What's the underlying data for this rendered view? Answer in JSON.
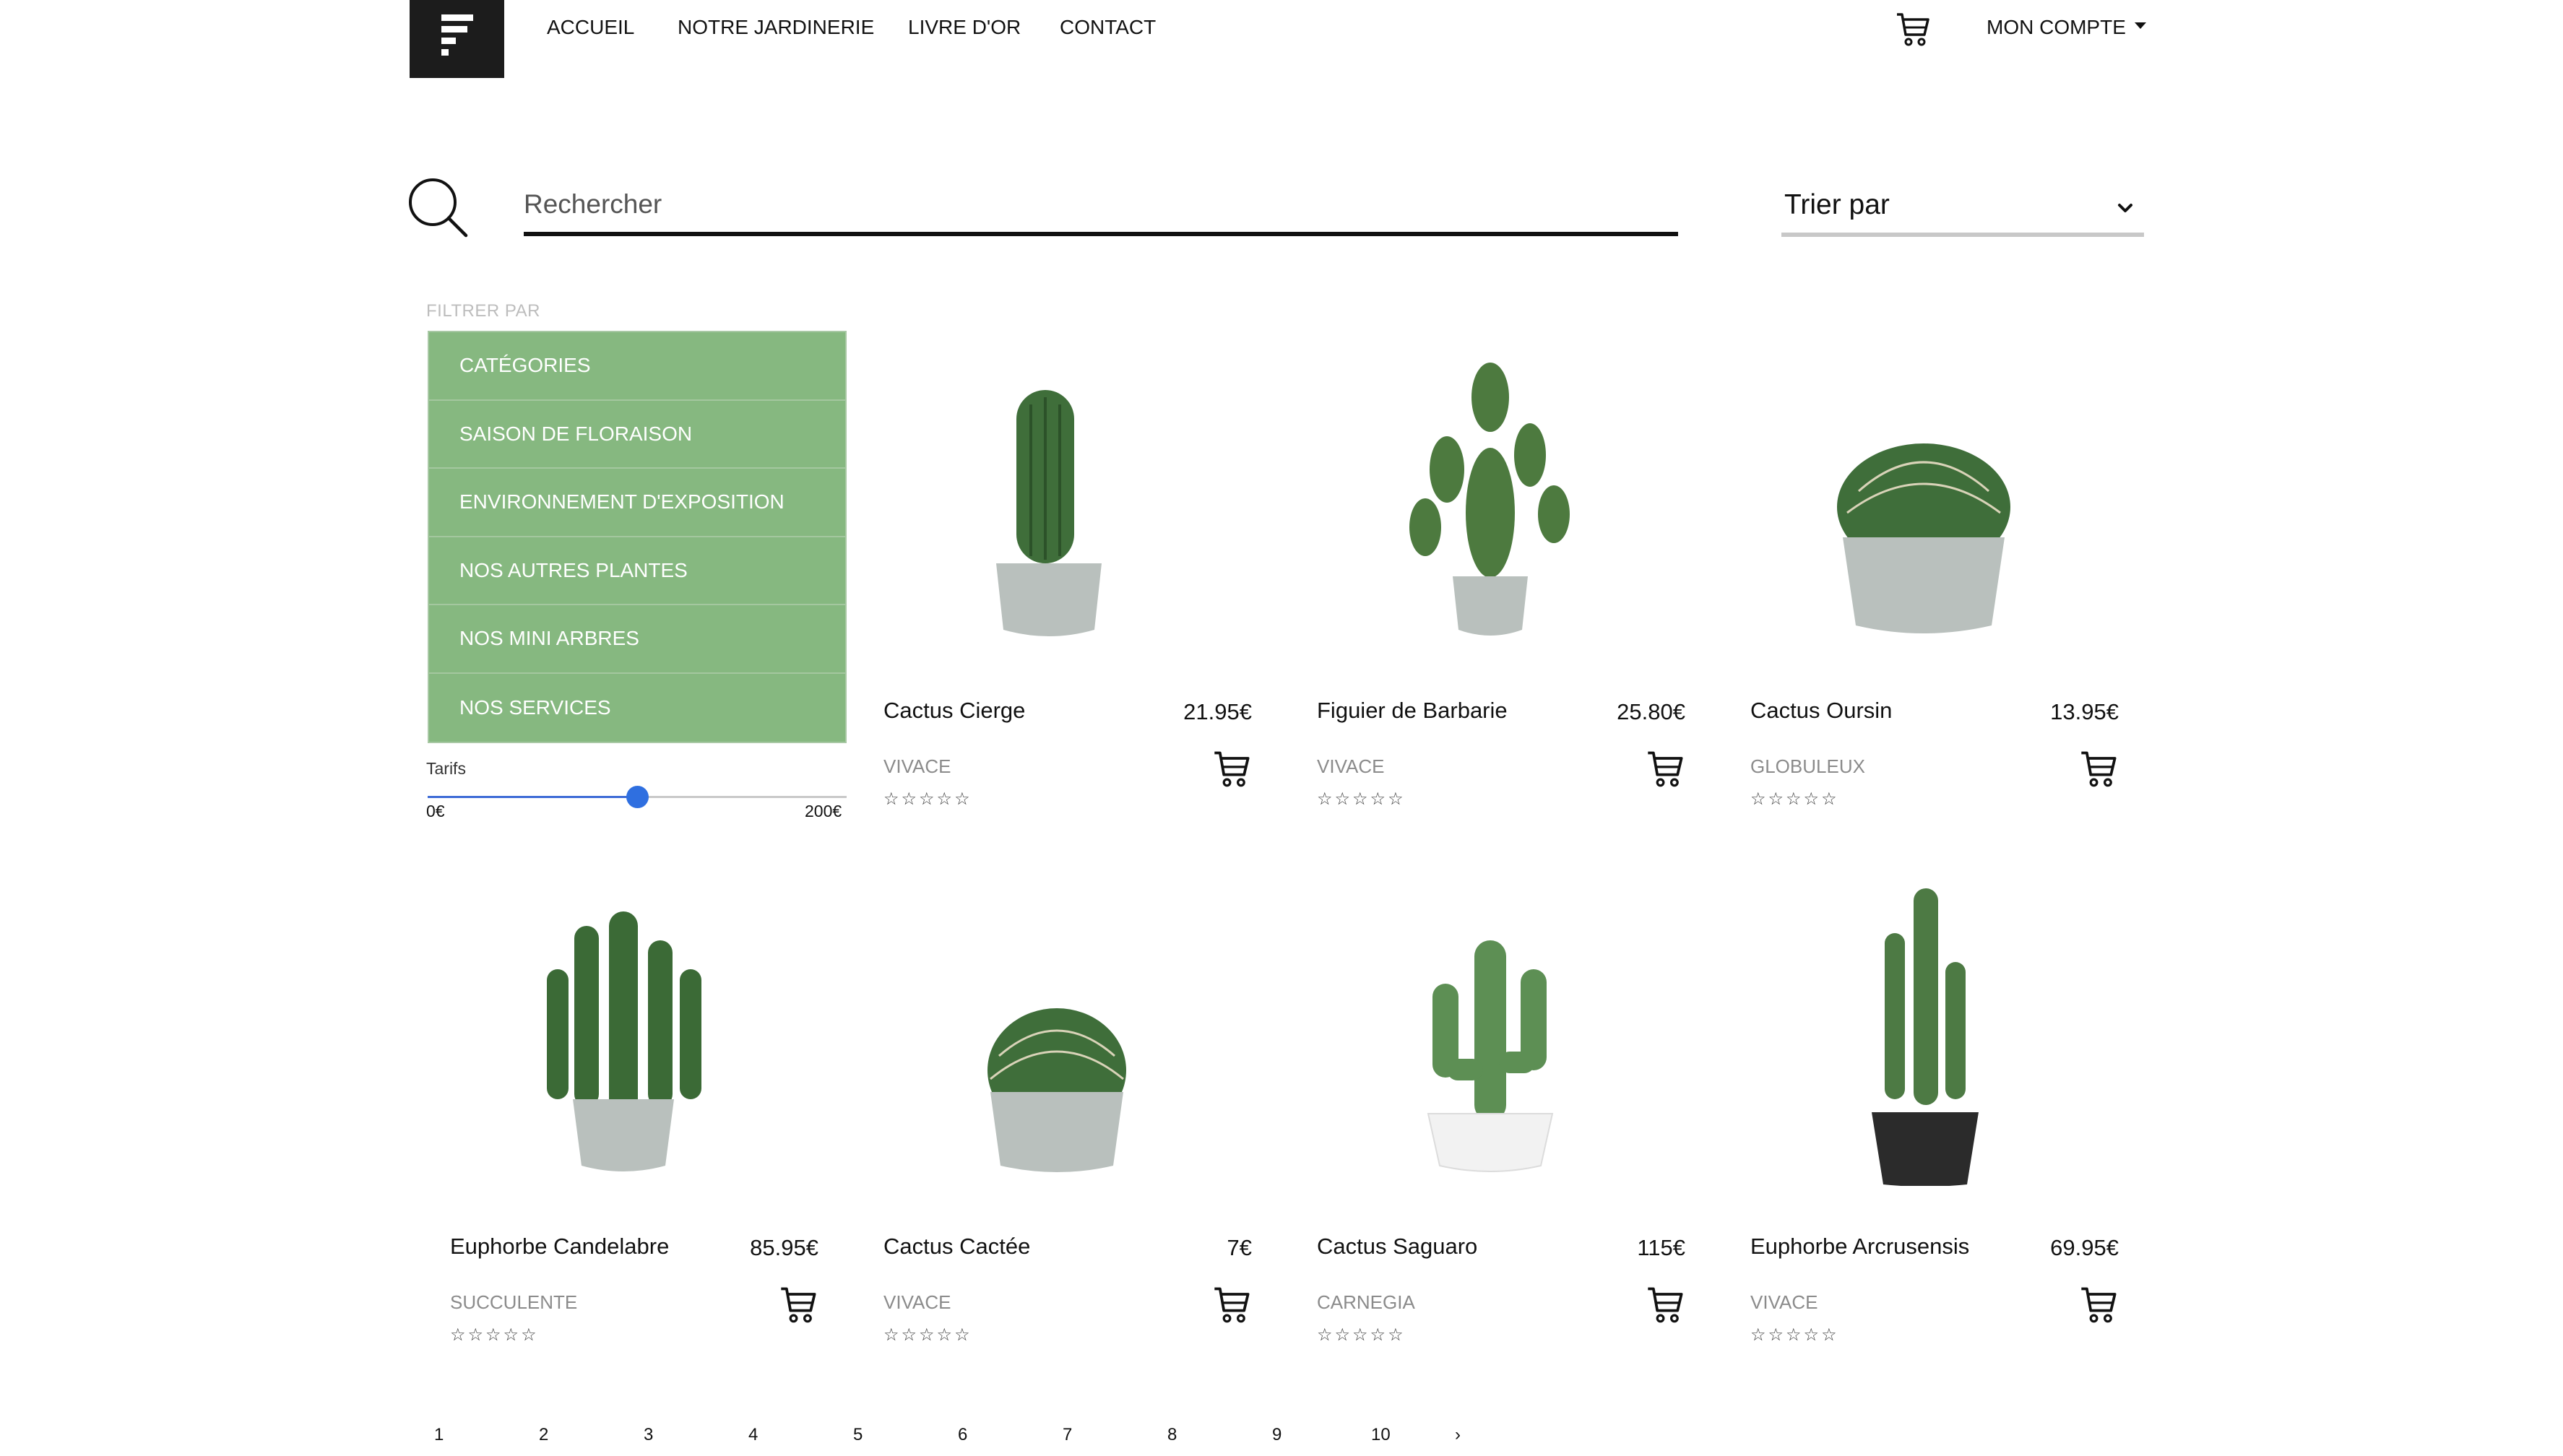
{
  "nav": {
    "items": [
      "ACCUEIL",
      "NOTRE JARDINERIE",
      "LIVRE D'OR",
      "CONTACT"
    ],
    "account_label": "MON COMPTE"
  },
  "search": {
    "placeholder": "Rechercher"
  },
  "sort": {
    "label": "Trier par"
  },
  "filter": {
    "title": "FILTRER PAR",
    "items": [
      "CATÉGORIES",
      "SAISON DE FLORAISON",
      "ENVIRONNEMENT D'EXPOSITION",
      "NOS AUTRES PLANTES",
      "NOS MINI ARBRES",
      "NOS SERVICES"
    ],
    "price_label": "Tarifs",
    "price_min": "0€",
    "price_max": "200€",
    "price_value_fraction": 0.5
  },
  "products": [
    {
      "name": "Cactus Cierge",
      "price": "21.95€",
      "category": "VIVACE",
      "stars": "☆☆☆☆☆",
      "icon": "column-cactus"
    },
    {
      "name": "Figuier de Barbarie",
      "price": "25.80€",
      "category": "VIVACE",
      "stars": "☆☆☆☆☆",
      "icon": "paddle-cactus"
    },
    {
      "name": "Cactus Oursin",
      "price": "13.95€",
      "category": "GLOBULEUX",
      "stars": "☆☆☆☆☆",
      "icon": "barrel-cactus"
    },
    {
      "name": "Euphorbe Candelabre",
      "price": "85.95€",
      "category": "SUCCULENTE",
      "stars": "☆☆☆☆☆",
      "icon": "candelabra-cactus"
    },
    {
      "name": "Cactus Cactée",
      "price": "7€",
      "category": "VIVACE",
      "stars": "☆☆☆☆☆",
      "icon": "barrel-cactus"
    },
    {
      "name": "Cactus Saguaro",
      "price": "115€",
      "category": "CARNEGIA",
      "stars": "☆☆☆☆☆",
      "icon": "saguaro-cactus"
    },
    {
      "name": "Euphorbe Arcrusensis",
      "price": "69.95€",
      "category": "VIVACE",
      "stars": "☆☆☆☆☆",
      "icon": "tall-cactus-black-pot"
    }
  ],
  "pagination": [
    "1",
    "2",
    "3",
    "4",
    "5",
    "6",
    "7",
    "8",
    "9",
    "10",
    "›"
  ],
  "colors": {
    "filter_green": "#86b880",
    "slider_blue": "#2f6fe0",
    "cactus_green": "#3f6e3a",
    "pot_grey": "#b9c0bd"
  }
}
